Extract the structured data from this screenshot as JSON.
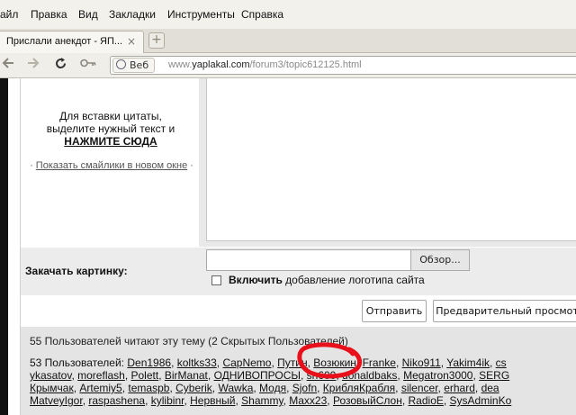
{
  "menubar": {
    "items": [
      "айл",
      "Правка",
      "Вид",
      "Закладки",
      "Инструменты",
      "Справка"
    ]
  },
  "tab": {
    "title": "Прислали анекдот - ЯП...",
    "close_glyph": "×",
    "new_tab_glyph": "+"
  },
  "navbar": {
    "web_label": "Веб",
    "url_prefix": "www.",
    "url_domain": "yaplakal.com",
    "url_path": "/forum3/topic612125.html"
  },
  "quote_hint": {
    "line1": "Для вставки цитаты,",
    "line2": "выделите нужный текст и",
    "action": "НАЖМИТЕ СЮДА"
  },
  "smiles": {
    "bullet": "·",
    "link": "Показать смайлики в новом окне"
  },
  "upload": {
    "label": "Закачать картинку:",
    "browse": "Обзор...",
    "checkbox_bold": "Включить",
    "checkbox_rest": " добавление логотипа сайта"
  },
  "buttons": {
    "send": "Отправить",
    "preview": "Предварительный просмотр"
  },
  "online": {
    "title": "55 Пользователей читают эту тему (2 Скрытых Пользователей)",
    "members_prefix": "53 Пользователей: ",
    "rows": [
      [
        "Den1986",
        "koltks33",
        "CapNemo",
        "Путин",
        "Возюкин",
        "Franke",
        "Niko911",
        "Yakim4ik",
        "cs"
      ],
      [
        "ykasatov",
        "moreflash",
        "Polett",
        "BirManat",
        "ОДНИВОПРОСЫ",
        "sh600",
        "donaldbaks",
        "Megatron3000",
        "SERG"
      ],
      [
        "Крымчак",
        "Artemiy5",
        "temaspb",
        "Cyberik",
        "Wawka",
        "Модя",
        "Sjofn",
        "КрибляКрабля",
        "silencer",
        "erhard",
        "dea"
      ],
      [
        "MatveyIgor",
        "raspashena",
        "kylibinr",
        "Нервный",
        "Shammy",
        "Maxx23",
        "РозовыйСлон",
        "RadioE",
        "SysAdminKo"
      ]
    ]
  },
  "colors": {
    "highlight_circle": "#e8101a"
  }
}
